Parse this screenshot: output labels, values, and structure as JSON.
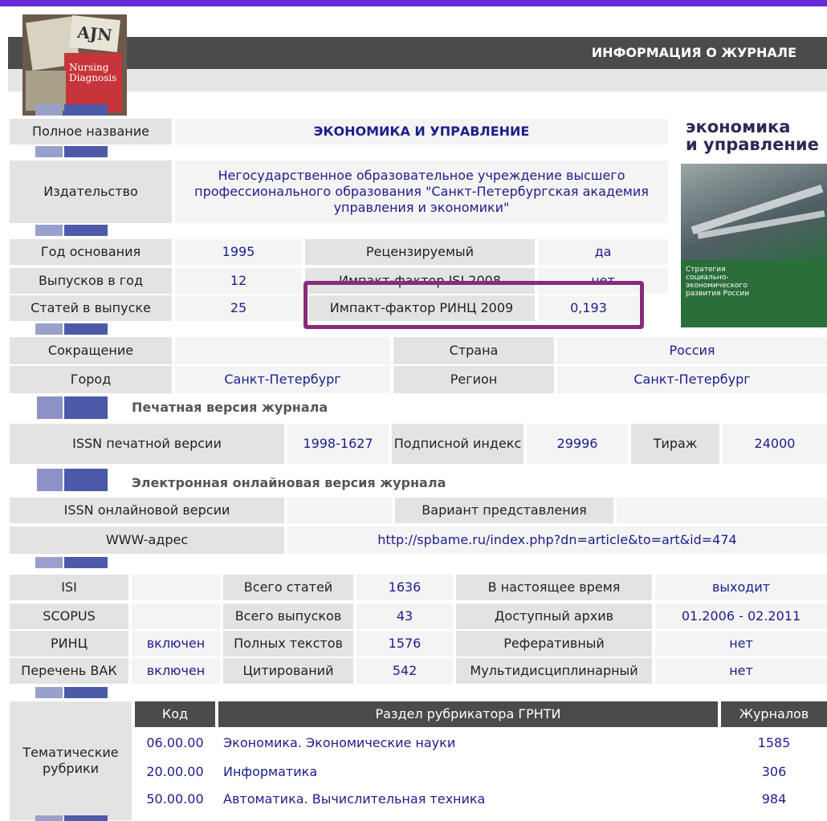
{
  "header": {
    "title": "ИНФОРМАЦИЯ О ЖУРНАЛЕ"
  },
  "logo": {
    "text1": "AJN",
    "text2": "Nursing",
    "text3": "Diagnosis"
  },
  "cover": {
    "title1": "экономика",
    "title2": "и управление",
    "subtitle": "Стратегия социально-экономического развития России"
  },
  "journal": {
    "full_name_label": "Полное название",
    "full_name": "ЭКОНОМИКА И УПРАВЛЕНИЕ",
    "publisher_label": "Издательство",
    "publisher": "Негосударственное образовательное учреждение высшего профессионального образования \"Санкт-Петербургская академия управления и экономики\"",
    "founded_label": "Год основания",
    "founded": "1995",
    "reviewed_label": "Рецензируемый",
    "reviewed": "да",
    "issues_label": "Выпусков в год",
    "issues": "12",
    "isi_if_label": "Импакт-фактор ISI 2008",
    "isi_if": "нет",
    "articles_label": "Статей в выпуске",
    "articles": "25",
    "rinc_if_label": "Импакт-фактор РИНЦ 2009",
    "rinc_if": "0,193",
    "abbr_label": "Сокращение",
    "abbr": "",
    "country_label": "Страна",
    "country": "Россия",
    "city_label": "Город",
    "city": "Санкт-Петербург",
    "region_label": "Регион",
    "region": "Санкт-Петербург"
  },
  "print": {
    "section_title": "Печатная версия журнала",
    "issn_label": "ISSN печатной версии",
    "issn": "1998-1627",
    "sub_index_label": "Подписной индекс",
    "sub_index": "29996",
    "circulation_label": "Тираж",
    "circulation": "24000"
  },
  "online": {
    "section_title": "Электронная онлайновая версия журнала",
    "issn_label": "ISSN онлайновой версии",
    "issn": "",
    "variant_label": "Вариант представления",
    "variant": "",
    "www_label": "WWW-адрес",
    "www": "http://spbame.ru/index.php?dn=article&to=art&id=474"
  },
  "indexing": {
    "rows": [
      {
        "db": "ISI",
        "db_val": "",
        "stat": "Всего статей",
        "stat_val": "1636",
        "prop": "В настоящее время",
        "prop_val": "выходит"
      },
      {
        "db": "SCOPUS",
        "db_val": "",
        "stat": "Всего выпусков",
        "stat_val": "43",
        "prop": "Доступный архив",
        "prop_val": "01.2006 - 02.2011"
      },
      {
        "db": "РИНЦ",
        "db_val": "включен",
        "stat": "Полных текстов",
        "stat_val": "1576",
        "prop": "Реферативный",
        "prop_val": "нет"
      },
      {
        "db": "Перечень ВАК",
        "db_val": "включен",
        "stat": "Цитирований",
        "stat_val": "542",
        "prop": "Мультидисциплинарный",
        "prop_val": "нет"
      }
    ]
  },
  "rubrics": {
    "label": "Тематические рубрики",
    "col_code": "Код",
    "col_section": "Раздел рубрикатора ГРНТИ",
    "col_journals": "Журналов",
    "rows": [
      {
        "code": "06.00.00",
        "section": "Экономика. Экономические науки",
        "journals": "1585"
      },
      {
        "code": "20.00.00",
        "section": "Информатика",
        "journals": "306"
      },
      {
        "code": "50.00.00",
        "section": "Автоматика. Вычислительная техника",
        "journals": "984"
      }
    ]
  },
  "colors": {
    "accent": "#6a2bd9",
    "highlight": "#8a2b7a",
    "link": "#1d1d8a"
  }
}
